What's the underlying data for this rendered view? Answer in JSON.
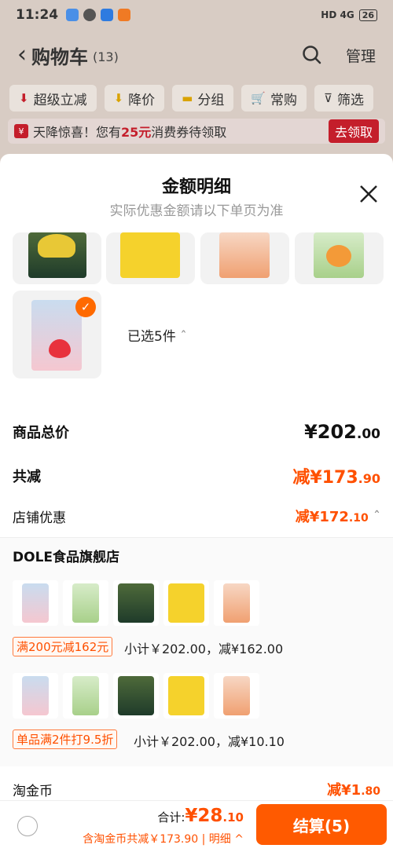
{
  "status_bar": {
    "time": "11:24",
    "signal": "HD 4G",
    "battery": "26"
  },
  "header": {
    "title": "购物车",
    "count": "(13)",
    "manage_label": "管理"
  },
  "filters": [
    {
      "label": "超级立减",
      "icon": "arrow-down-icon"
    },
    {
      "label": "降价",
      "icon": "price-drop-icon"
    },
    {
      "label": "分组",
      "icon": "folder-icon"
    },
    {
      "label": "常购",
      "icon": "cart-icon"
    },
    {
      "label": "筛选",
      "icon": "filter-icon"
    }
  ],
  "promo": {
    "text_a": "天降惊喜！您有",
    "amount": "25元",
    "text_b": "消费券待领取",
    "button": "去领取"
  },
  "sheet": {
    "title": "金额明细",
    "subtitle": "实际优惠金额请以下单页为准",
    "selected": "已选5件",
    "products": [
      "香蕉片",
      "香蕉片",
      "黄桃",
      "黄桃",
      "草莓"
    ],
    "total_label": "商品总价",
    "total_int": "¥202",
    "total_dec": ".00",
    "reduce_label": "共减",
    "reduce_int": "减¥173",
    "reduce_dec": ".90",
    "shop_discount_label": "店铺优惠",
    "shop_discount_int": "减¥172",
    "shop_discount_dec": ".10",
    "shop_name": "DOLE食品旗舰店",
    "group1_tag": "满200元减162元",
    "group1_sub": "小计￥202.00，减¥162.00",
    "group2_tag": "单品满2件打9.5折",
    "group2_sub": "小计￥202.00，减¥10.10",
    "coin_label": "淘金币",
    "coin_int": "减¥1",
    "coin_dec": ".80"
  },
  "bottom": {
    "total_prefix": "合计:",
    "total_int": "¥28",
    "total_dec": ".10",
    "subline": "含淘金币共减￥173.90 | 明细 ^",
    "checkout": "结算(5)"
  },
  "colors": {
    "accent": "#ff5000",
    "brand_red": "#c41e2b"
  }
}
